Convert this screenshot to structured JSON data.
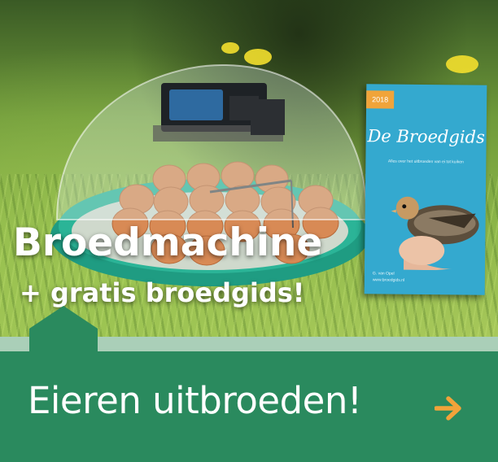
{
  "banner": {
    "headline": "Broedmachine",
    "subheadline": "+ gratis broedgids!",
    "cta_label": "Eieren uitbroeden!",
    "cta_arrow_icon": "arrow-right-icon"
  },
  "booklet": {
    "year": "2018",
    "title": "De Broedgids",
    "subtitle": "Alles over het uitbroeden van ei tot kuiken",
    "author": "G. van Opel",
    "url": "www.broedgids.nl"
  },
  "colors": {
    "cta_background": "#2a8a5e",
    "strip": "#aacfb8",
    "arrow": "#f2a33a",
    "booklet": "#34a9cf",
    "booklet_badge": "#f0a43a",
    "incubator_base": "#22a48a"
  }
}
